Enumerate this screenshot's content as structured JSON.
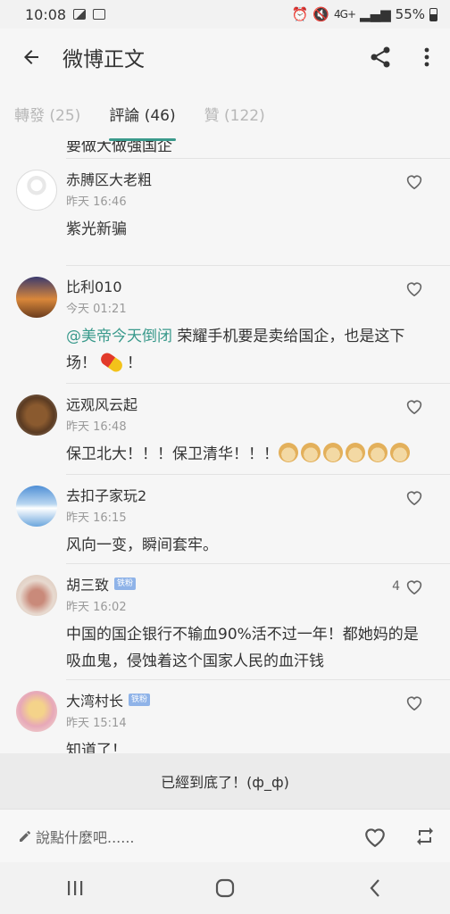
{
  "status_bar": {
    "time": "10:08",
    "network": "4G+",
    "battery": "55%"
  },
  "app_bar": {
    "title": "微博正文",
    "back_icon": "arrow-back-icon",
    "share_icon": "share-icon",
    "more_icon": "more-vert-icon"
  },
  "tabs": [
    {
      "label": "轉發 (25)",
      "active": false
    },
    {
      "label": "評論 (46)",
      "active": true
    },
    {
      "label": "贊 (122)",
      "active": false
    }
  ],
  "partial_text": "要做大做強国企",
  "comments": [
    {
      "name": "赤膊区大老粗",
      "time": "昨天 16:46",
      "text": "紫光新骗",
      "likes": "",
      "badge": ""
    },
    {
      "name": "比利010",
      "time": "今天 01:21",
      "mention": "@美帝今天倒闭",
      "text": " 荣耀手机要是卖给国企，也是这下场！",
      "text_tail": "！",
      "likes": "",
      "badge": ""
    },
    {
      "name": "远观风云起",
      "time": "昨天 16:48",
      "text": "保卫北大！！！保卫清华！！！",
      "likes": "",
      "badge": ""
    },
    {
      "name": "去扣子家玩2",
      "time": "昨天 16:15",
      "text": "风向一变，瞬间套牢。",
      "likes": "",
      "badge": ""
    },
    {
      "name": "胡三致",
      "time": "昨天 16:02",
      "text": "中国的国企银行不输血90%活不过一年！都她妈的是吸血鬼，侵蚀着这个国家人民的血汗钱",
      "likes": "4",
      "badge": "铁粉"
    },
    {
      "name": "大湾村长",
      "time": "昨天 15:14",
      "text": "知道了！",
      "likes": "",
      "badge": "铁粉"
    }
  ],
  "end_text": "已經到底了！(ф_ф)",
  "composer": {
    "placeholder": "說點什麼吧......"
  },
  "colors": {
    "accent": "#3a9a8c",
    "badge": "#8fb3e8"
  }
}
